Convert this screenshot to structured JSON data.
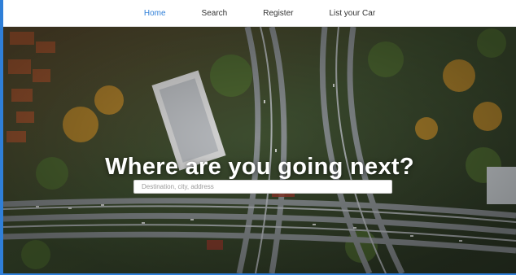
{
  "nav": {
    "items": [
      {
        "label": "Home",
        "active": true
      },
      {
        "label": "Search",
        "active": false
      },
      {
        "label": "Register",
        "active": false
      },
      {
        "label": "List your Car",
        "active": false
      }
    ]
  },
  "hero": {
    "image_subject": "aerial photo of highway interchange and city",
    "headline": "Where are you going next?",
    "search_placeholder": "Destination, city, address"
  },
  "colors": {
    "accent": "#2f7fd8",
    "nav_bg": "#ffffff",
    "nav_text": "#333333",
    "headline": "#ffffff"
  }
}
